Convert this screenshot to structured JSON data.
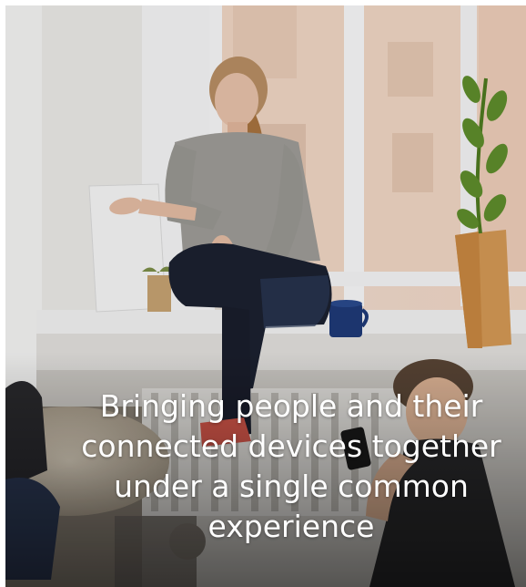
{
  "hero": {
    "image_alt": "Woman sitting on a window sill while another woman uses a phone",
    "caption_lines": [
      "Bringing people and their",
      "connected devices together",
      "under a single common",
      "experience"
    ]
  },
  "colors": {
    "caption_text": "#ffffff",
    "window_frame": "#f4f5f6",
    "sweater": "#9f9d98",
    "jeans": "#1c2130",
    "mug": "#1f3a78",
    "vase": "#d59a55",
    "plant": "#5f8e2c"
  }
}
